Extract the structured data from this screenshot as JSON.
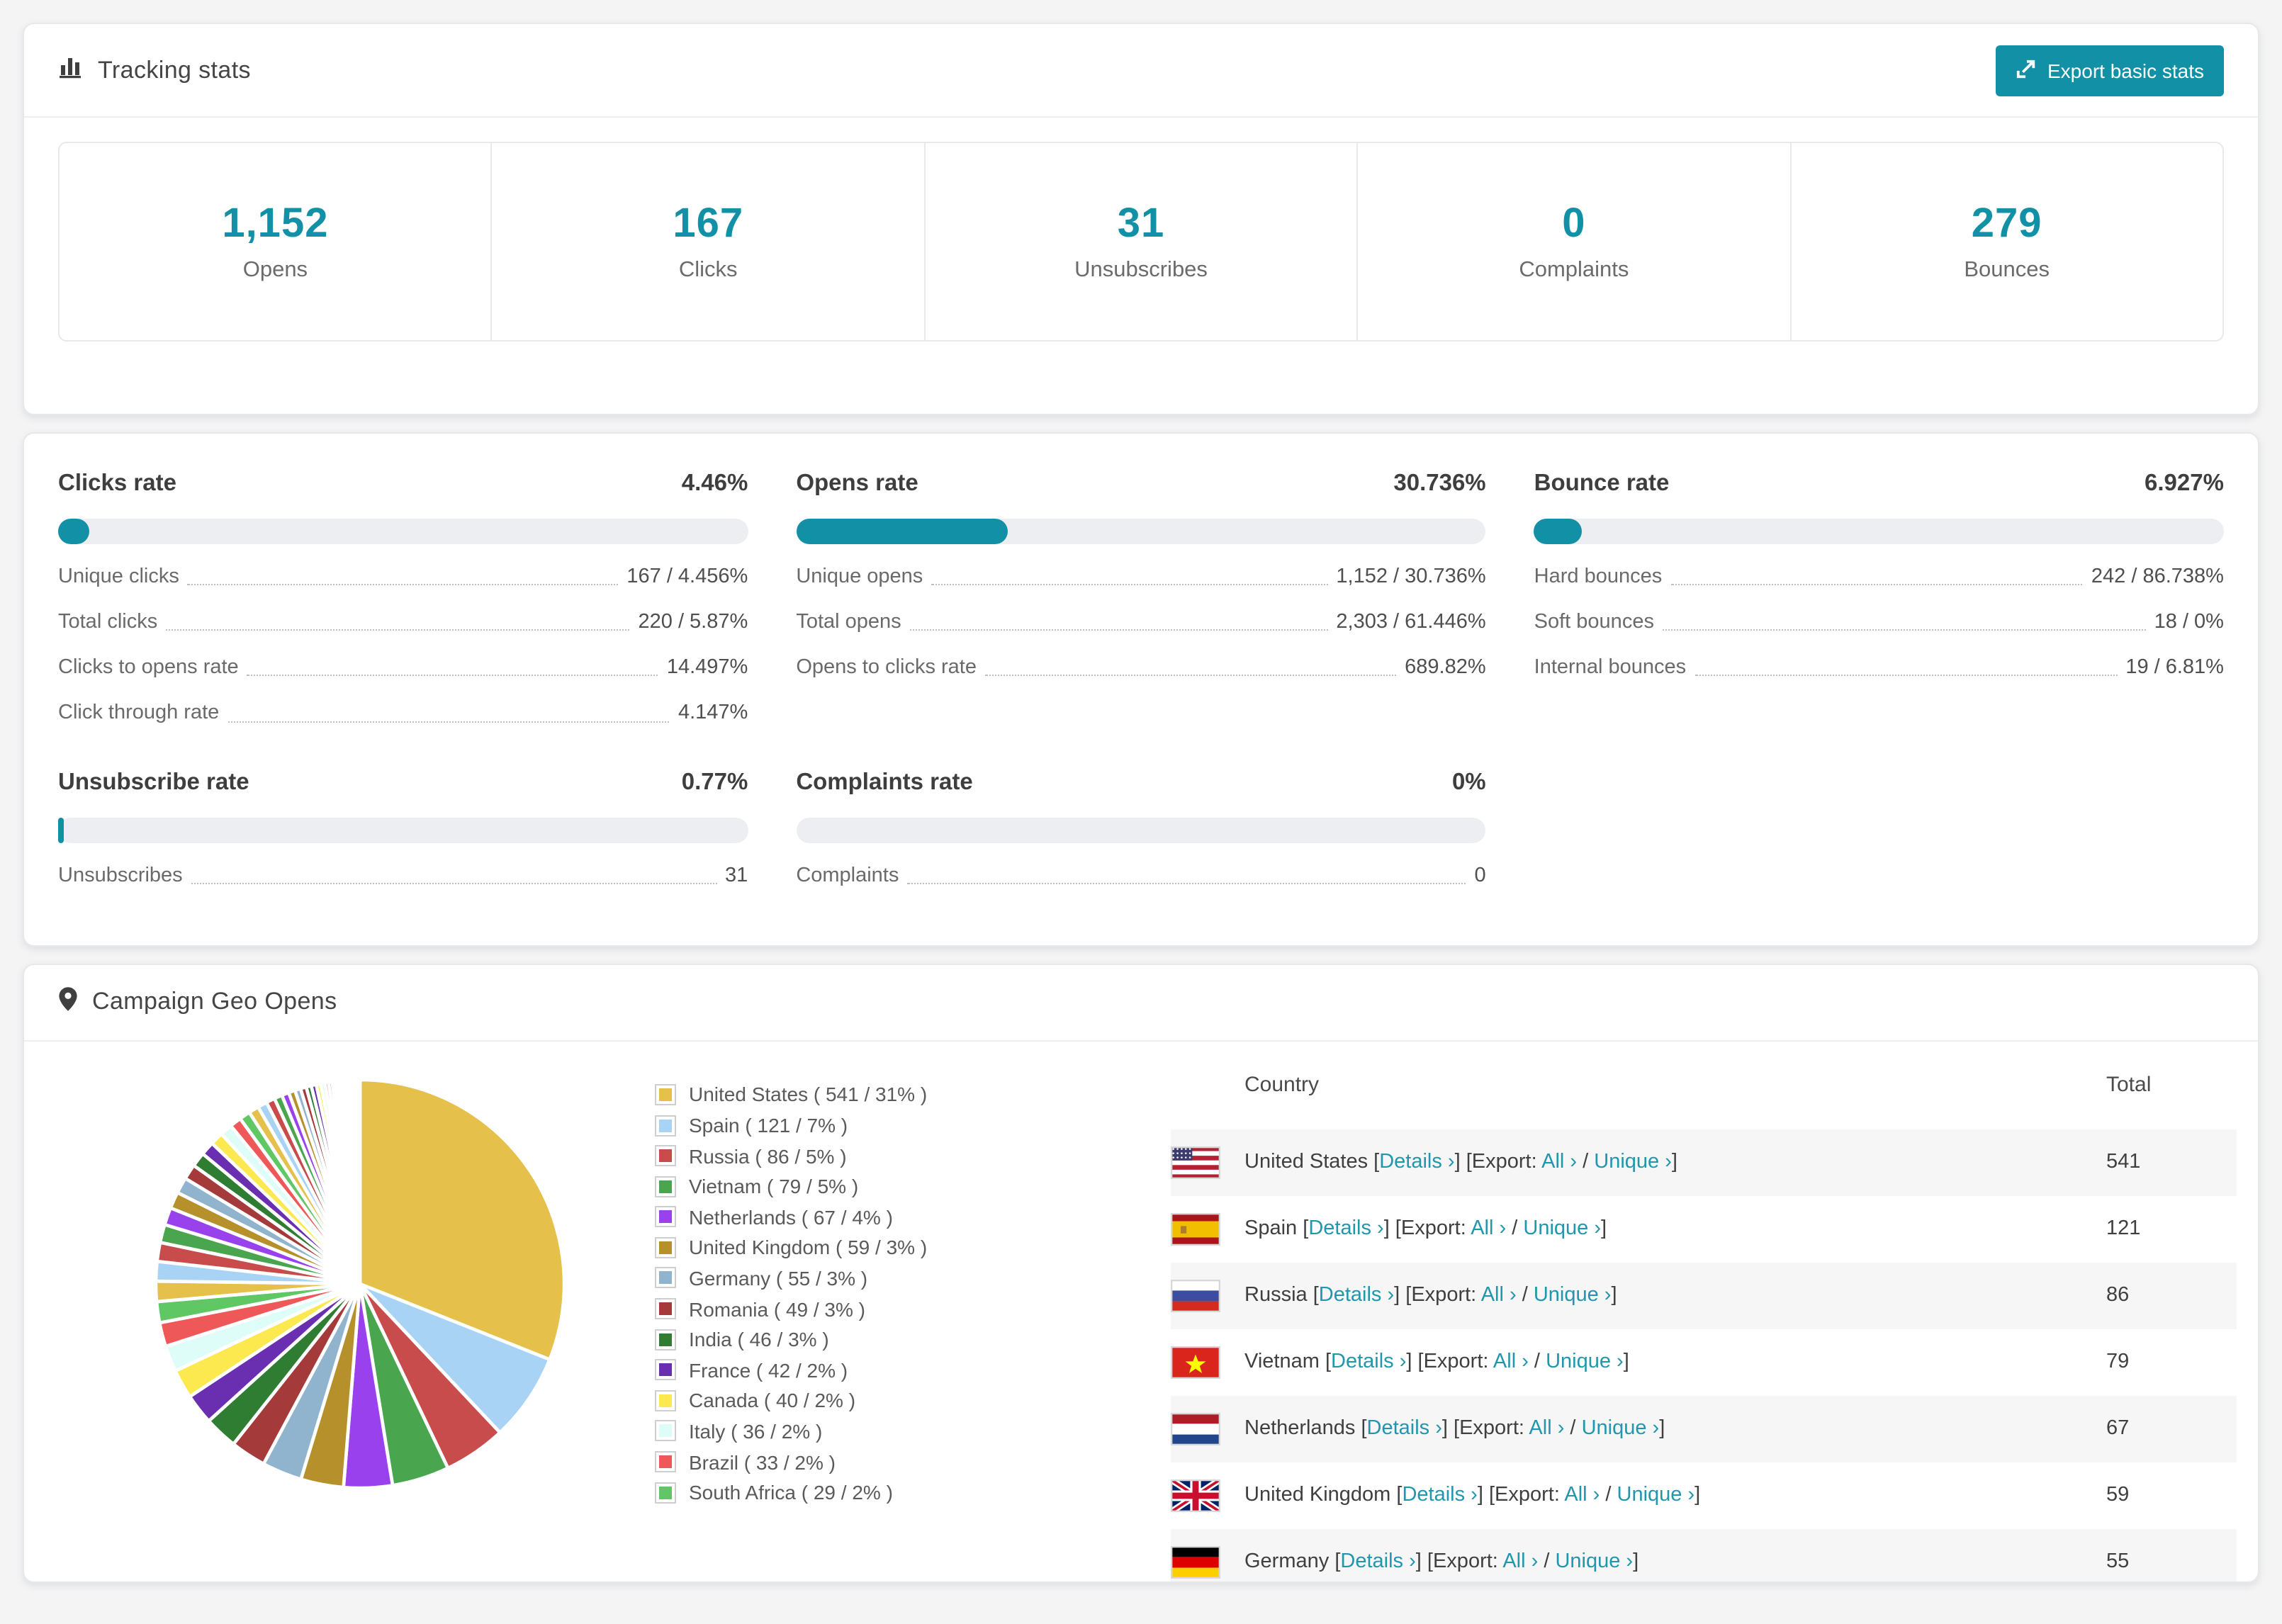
{
  "accent": "#1291a6",
  "link_color": "#2196ad",
  "header": {
    "title": "Tracking stats",
    "export_label": "Export basic stats"
  },
  "stats": [
    {
      "value": "1,152",
      "label": "Opens"
    },
    {
      "value": "167",
      "label": "Clicks"
    },
    {
      "value": "31",
      "label": "Unsubscribes"
    },
    {
      "value": "0",
      "label": "Complaints"
    },
    {
      "value": "279",
      "label": "Bounces"
    }
  ],
  "rates": [
    {
      "title": "Clicks rate",
      "value": "4.46%",
      "pct": 4.46,
      "rows": [
        [
          "Unique clicks",
          "167 / 4.456%"
        ],
        [
          "Total clicks",
          "220 / 5.87%"
        ],
        [
          "Clicks to opens rate",
          "14.497%"
        ],
        [
          "Click through rate",
          "4.147%"
        ]
      ]
    },
    {
      "title": "Opens rate",
      "value": "30.736%",
      "pct": 30.736,
      "rows": [
        [
          "Unique opens",
          "1,152 / 30.736%"
        ],
        [
          "Total opens",
          "2,303 / 61.446%"
        ],
        [
          "Opens to clicks rate",
          "689.82%"
        ]
      ]
    },
    {
      "title": "Bounce rate",
      "value": "6.927%",
      "pct": 6.927,
      "rows": [
        [
          "Hard bounces",
          "242 / 86.738%"
        ],
        [
          "Soft bounces",
          "18 / 0%"
        ],
        [
          "Internal bounces",
          "19 / 6.81%"
        ]
      ]
    },
    {
      "title": "Unsubscribe rate",
      "value": "0.77%",
      "pct": 0.77,
      "rows": [
        [
          "Unsubscribes",
          "31"
        ]
      ]
    },
    {
      "title": "Complaints rate",
      "value": "0%",
      "pct": 0,
      "rows": [
        [
          "Complaints",
          "0"
        ]
      ]
    }
  ],
  "geo": {
    "title": "Campaign Geo Opens",
    "table": {
      "headers": [
        "Country",
        "Total"
      ],
      "link_labels": {
        "details": "Details",
        "export": "Export:",
        "all": "All",
        "unique": "Unique",
        "chevron": "›"
      },
      "rows": [
        {
          "country": "United States",
          "flag": "us",
          "total": "541"
        },
        {
          "country": "Spain",
          "flag": "es",
          "total": "121"
        },
        {
          "country": "Russia",
          "flag": "ru",
          "total": "86"
        },
        {
          "country": "Vietnam",
          "flag": "vn",
          "total": "79"
        },
        {
          "country": "Netherlands",
          "flag": "nl",
          "total": "67"
        },
        {
          "country": "United Kingdom",
          "flag": "gb",
          "total": "59"
        },
        {
          "country": "Germany",
          "flag": "de",
          "total": "55"
        }
      ]
    }
  },
  "chart_data": {
    "type": "pie",
    "title": "Campaign Geo Opens",
    "legend_position": "right",
    "start_angle_deg": 0,
    "direction": "clockwise",
    "series": [
      {
        "label": "United States",
        "value": 541,
        "pct": 31,
        "color": "#E5C04B"
      },
      {
        "label": "Spain",
        "value": 121,
        "pct": 7,
        "color": "#A9D3F5"
      },
      {
        "label": "Russia",
        "value": 86,
        "pct": 5,
        "color": "#C94C4C"
      },
      {
        "label": "Vietnam",
        "value": 79,
        "pct": 5,
        "color": "#4AA64E"
      },
      {
        "label": "Netherlands",
        "value": 67,
        "pct": 4,
        "color": "#9A41EE"
      },
      {
        "label": "United Kingdom",
        "value": 59,
        "pct": 3,
        "color": "#B6912B"
      },
      {
        "label": "Germany",
        "value": 55,
        "pct": 3,
        "color": "#91B4CE"
      },
      {
        "label": "Romania",
        "value": 49,
        "pct": 3,
        "color": "#A43A3A"
      },
      {
        "label": "India",
        "value": 46,
        "pct": 3,
        "color": "#2E7D32"
      },
      {
        "label": "France",
        "value": 42,
        "pct": 2,
        "color": "#6A2FB0"
      },
      {
        "label": "Canada",
        "value": 40,
        "pct": 2,
        "color": "#FCE94F"
      },
      {
        "label": "Italy",
        "value": 36,
        "pct": 2,
        "color": "#DFFDF8"
      },
      {
        "label": "Brazil",
        "value": 33,
        "pct": 2,
        "color": "#EF5858"
      },
      {
        "label": "South Africa",
        "value": 29,
        "pct": 2,
        "color": "#5FC763"
      }
    ],
    "others_unlabeled": [
      28,
      27,
      26,
      25,
      24,
      23,
      22,
      21,
      20,
      19,
      18,
      17,
      16,
      15,
      14,
      13,
      12,
      11,
      10,
      9,
      8,
      8,
      7,
      7,
      6,
      6,
      5,
      5,
      4,
      4,
      3,
      3,
      3,
      2,
      2,
      2,
      2,
      1,
      1,
      1,
      1,
      1,
      1,
      1,
      1,
      1,
      1,
      1,
      1,
      1
    ],
    "legend_label_format": "Name ( value / pct% )"
  }
}
